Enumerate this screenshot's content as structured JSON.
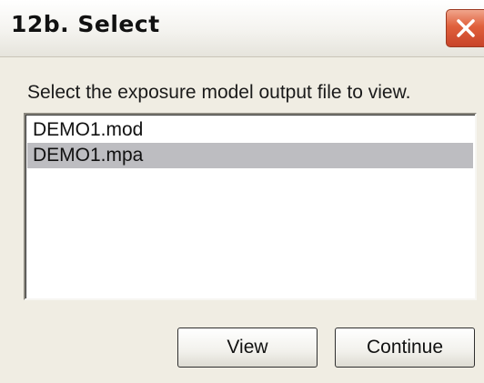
{
  "window": {
    "title": "12b. Select",
    "close_icon": "close-icon"
  },
  "dialog": {
    "instruction": "Select the exposure model output file to view.",
    "files": [
      {
        "name": "DEMO1.mod",
        "selected": false
      },
      {
        "name": "DEMO1.mpa",
        "selected": true
      }
    ],
    "buttons": {
      "view_label": "View",
      "continue_label": "Continue"
    }
  },
  "colors": {
    "close_button": "#e0603c",
    "selection": "#bdbdc1",
    "background": "#f0ede3"
  }
}
